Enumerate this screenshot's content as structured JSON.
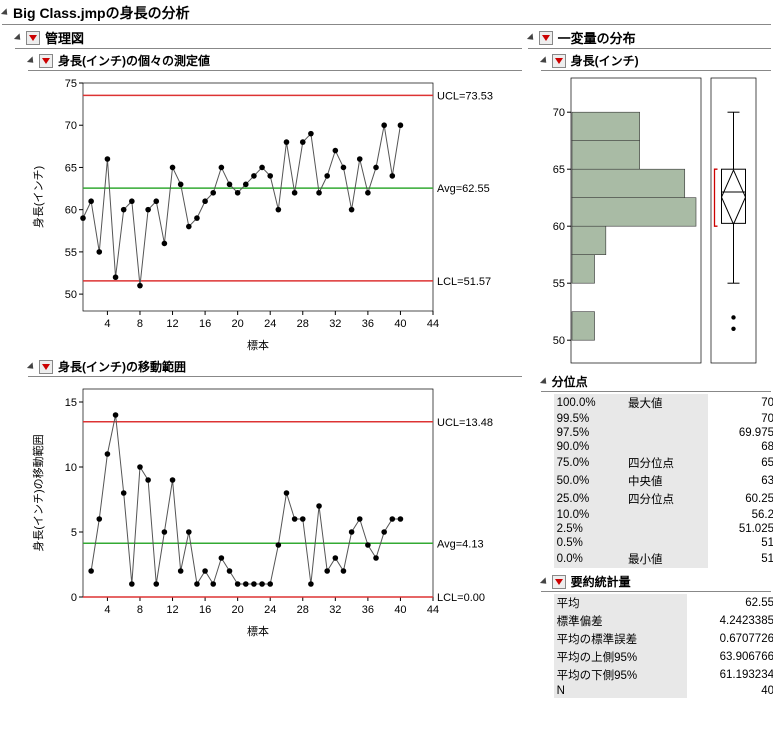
{
  "main_title": "Big Class.jmpの身長の分析",
  "left_section_title": "管理図",
  "right_section_title": "一変量の分布",
  "control_chart_title": "身長(インチ)の個々の測定値",
  "range_chart_title": "身長(インチ)の移動範囲",
  "dist_chart_title": "身長(インチ)",
  "quantiles_title": "分位点",
  "summary_title": "要約統計量",
  "x_axis_label": "標本",
  "y_axis_label_1": "身長(インチ)",
  "y_axis_label_2": "身長(インチ)の移動範囲",
  "control_labels": {
    "ucl": "UCL=73.53",
    "avg": "Avg=62.55",
    "lcl": "LCL=51.57"
  },
  "range_labels": {
    "ucl": "UCL=13.48",
    "avg": "Avg=4.13",
    "lcl": "LCL=0.00"
  },
  "quantiles": [
    {
      "pct": "100.0%",
      "name": "最大値",
      "val": "70"
    },
    {
      "pct": "99.5%",
      "name": "",
      "val": "70"
    },
    {
      "pct": "97.5%",
      "name": "",
      "val": "69.975"
    },
    {
      "pct": "90.0%",
      "name": "",
      "val": "68"
    },
    {
      "pct": "75.0%",
      "name": "四分位点",
      "val": "65"
    },
    {
      "pct": "50.0%",
      "name": "中央値",
      "val": "63"
    },
    {
      "pct": "25.0%",
      "name": "四分位点",
      "val": "60.25"
    },
    {
      "pct": "10.0%",
      "name": "",
      "val": "56.2"
    },
    {
      "pct": "2.5%",
      "name": "",
      "val": "51.025"
    },
    {
      "pct": "0.5%",
      "name": "",
      "val": "51"
    },
    {
      "pct": "0.0%",
      "name": "最小値",
      "val": "51"
    }
  ],
  "summary": [
    {
      "name": "平均",
      "val": "62.55"
    },
    {
      "name": "標準偏差",
      "val": "4.2423385"
    },
    {
      "name": "平均の標準誤差",
      "val": "0.6707726"
    },
    {
      "name": "平均の上側95%",
      "val": "63.906766"
    },
    {
      "name": "平均の下側95%",
      "val": "61.193234"
    },
    {
      "name": "N",
      "val": "40"
    }
  ],
  "chart_data": {
    "individuals": {
      "type": "line",
      "x_label": "標本",
      "y_label": "身長(インチ)",
      "x_range": [
        1,
        44
      ],
      "y_range": [
        48,
        75
      ],
      "x_ticks": [
        4,
        8,
        12,
        16,
        20,
        24,
        28,
        32,
        36,
        40,
        44
      ],
      "y_ticks": [
        50,
        55,
        60,
        65,
        70,
        75
      ],
      "values": [
        59,
        61,
        55,
        66,
        52,
        60,
        61,
        51,
        60,
        61,
        56,
        65,
        63,
        58,
        59,
        61,
        62,
        65,
        63,
        62,
        63,
        64,
        65,
        64,
        60,
        68,
        62,
        68,
        69,
        62,
        64,
        67,
        65,
        60,
        66,
        62,
        65,
        70,
        64,
        70
      ],
      "limits": {
        "ucl": 73.53,
        "avg": 62.55,
        "lcl": 51.57
      }
    },
    "moving_range": {
      "type": "line",
      "x_label": "標本",
      "y_label": "身長(インチ)の移動範囲",
      "x_range": [
        1,
        44
      ],
      "y_range": [
        0,
        16
      ],
      "x_ticks": [
        4,
        8,
        12,
        16,
        20,
        24,
        28,
        32,
        36,
        40,
        44
      ],
      "y_ticks": [
        0,
        5,
        10,
        15
      ],
      "values": [
        2,
        6,
        11,
        14,
        8,
        1,
        10,
        9,
        1,
        5,
        9,
        2,
        5,
        1,
        2,
        1,
        3,
        2,
        1,
        1,
        1,
        1,
        1,
        4,
        8,
        6,
        6,
        1,
        7,
        2,
        3,
        2,
        5,
        6,
        4,
        3,
        5,
        6,
        6
      ],
      "limits": {
        "ucl": 13.48,
        "avg": 4.13,
        "lcl": 0.0
      }
    },
    "histogram": {
      "type": "bar",
      "orientation": "horizontal",
      "y_range": [
        48,
        73
      ],
      "y_ticks": [
        50,
        55,
        60,
        65,
        70
      ],
      "bins": [
        {
          "lo": 50.0,
          "hi": 52.5,
          "count": 2
        },
        {
          "lo": 52.5,
          "hi": 55.0,
          "count": 0
        },
        {
          "lo": 55.0,
          "hi": 57.5,
          "count": 2
        },
        {
          "lo": 57.5,
          "hi": 60.0,
          "count": 3
        },
        {
          "lo": 60.0,
          "hi": 62.5,
          "count": 11
        },
        {
          "lo": 62.5,
          "hi": 65.0,
          "count": 10
        },
        {
          "lo": 65.0,
          "hi": 67.5,
          "count": 6
        },
        {
          "lo": 67.5,
          "hi": 70.0,
          "count": 6
        },
        {
          "lo": 70.0,
          "hi": 72.5,
          "count": 0
        }
      ]
    },
    "boxplot": {
      "type": "boxplot",
      "min": 55,
      "q1": 60.25,
      "median": 63,
      "q3": 65,
      "max": 70,
      "mean": 62.55,
      "outliers": [
        51,
        52
      ],
      "shortest_half": [
        60,
        65
      ]
    }
  }
}
